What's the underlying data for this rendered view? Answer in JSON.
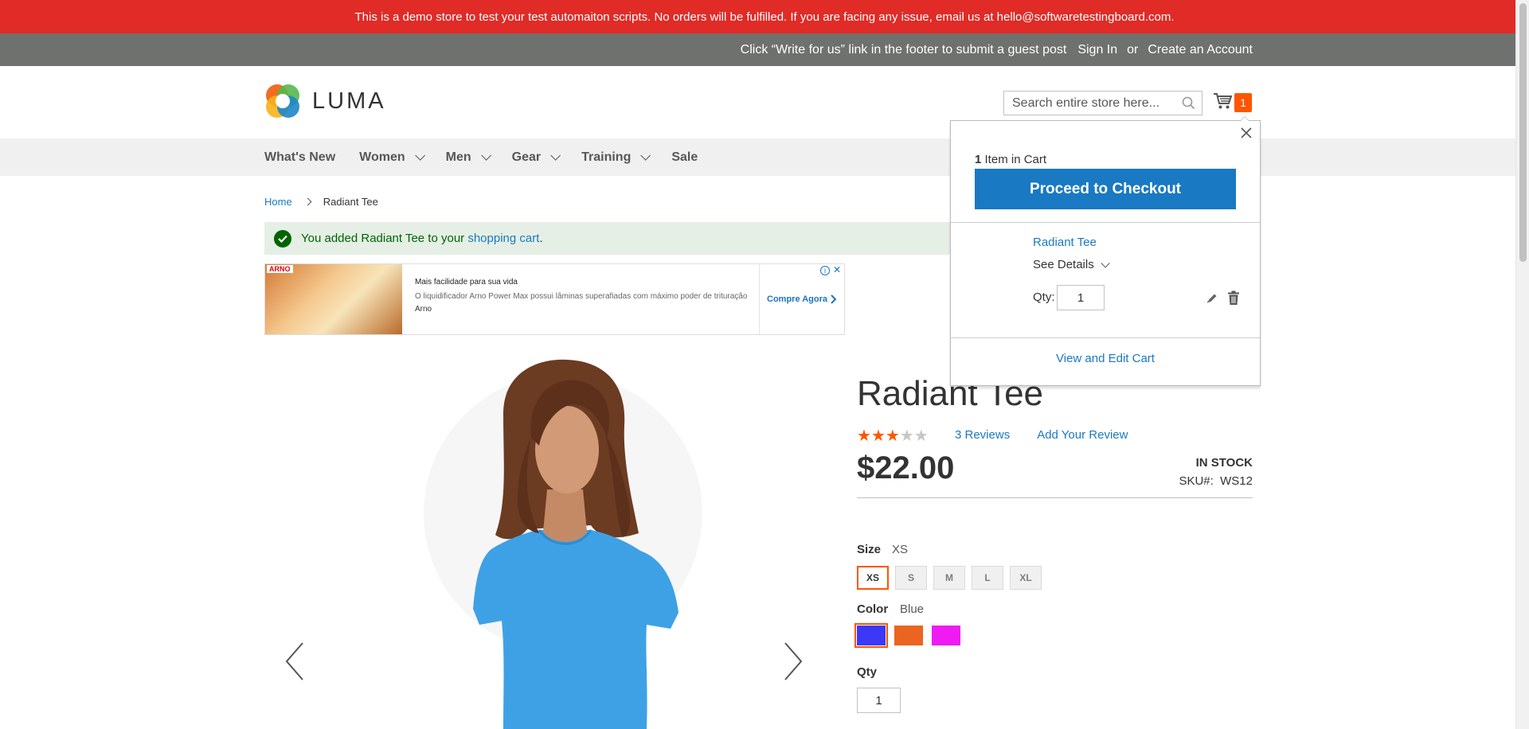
{
  "demo_notice": "This is a demo store to test your test automaiton scripts. No orders will be fulfilled. If you are facing any issue, email us at hello@softwaretestingboard.com.",
  "panel": {
    "guest_post": "Click “Write for us” link in the footer to submit a guest post",
    "sign_in": "Sign In",
    "or": "or",
    "create_account": "Create an Account"
  },
  "logo": {
    "text": "LUMA"
  },
  "search": {
    "placeholder": "Search entire store here..."
  },
  "cart": {
    "count": "1"
  },
  "nav": {
    "items": [
      {
        "label": "What's New"
      },
      {
        "label": "Women"
      },
      {
        "label": "Men"
      },
      {
        "label": "Gear"
      },
      {
        "label": "Training"
      },
      {
        "label": "Sale"
      }
    ]
  },
  "breadcrumb": {
    "home": "Home",
    "current": "Radiant Tee"
  },
  "message": {
    "text": "You added Radiant Tee to your",
    "link": "shopping cart",
    "end": "."
  },
  "ad": {
    "brand": "ARNO",
    "title": "Mais facilidade para sua vida",
    "subtitle": "O liquidificador Arno Power Max possui lâminas superafiadas com máximo poder de trituração",
    "advertiser": "Arno",
    "cta": "Compre Agora"
  },
  "product": {
    "title": "Radiant Tee",
    "rating_stars": 3,
    "rating_max": 5,
    "reviews": "3  Reviews",
    "add_review": "Add Your Review",
    "price": "$22.00",
    "stock": "In stock",
    "sku_label": "SKU#:",
    "sku": "WS12",
    "size_label": "Size",
    "size_selected": "XS",
    "sizes": [
      "XS",
      "S",
      "M",
      "L",
      "XL"
    ],
    "color_label": "Color",
    "color_selected": "Blue",
    "colors": [
      "#3b39f6",
      "#eb6420",
      "#ef1bf2"
    ],
    "qty_label": "Qty",
    "qty": "1"
  },
  "minicart": {
    "count": "1",
    "count_text": "Item in Cart",
    "checkout": "Proceed to Checkout",
    "item_name": "Radiant Tee",
    "see_details": "See Details",
    "qty_label": "Qty:",
    "qty": "1",
    "view_edit": "View and Edit Cart"
  },
  "colors": {
    "demo_bar": "#e02b27",
    "panel": "#6e716e",
    "link": "#1979c3",
    "accent": "#ff5501"
  }
}
